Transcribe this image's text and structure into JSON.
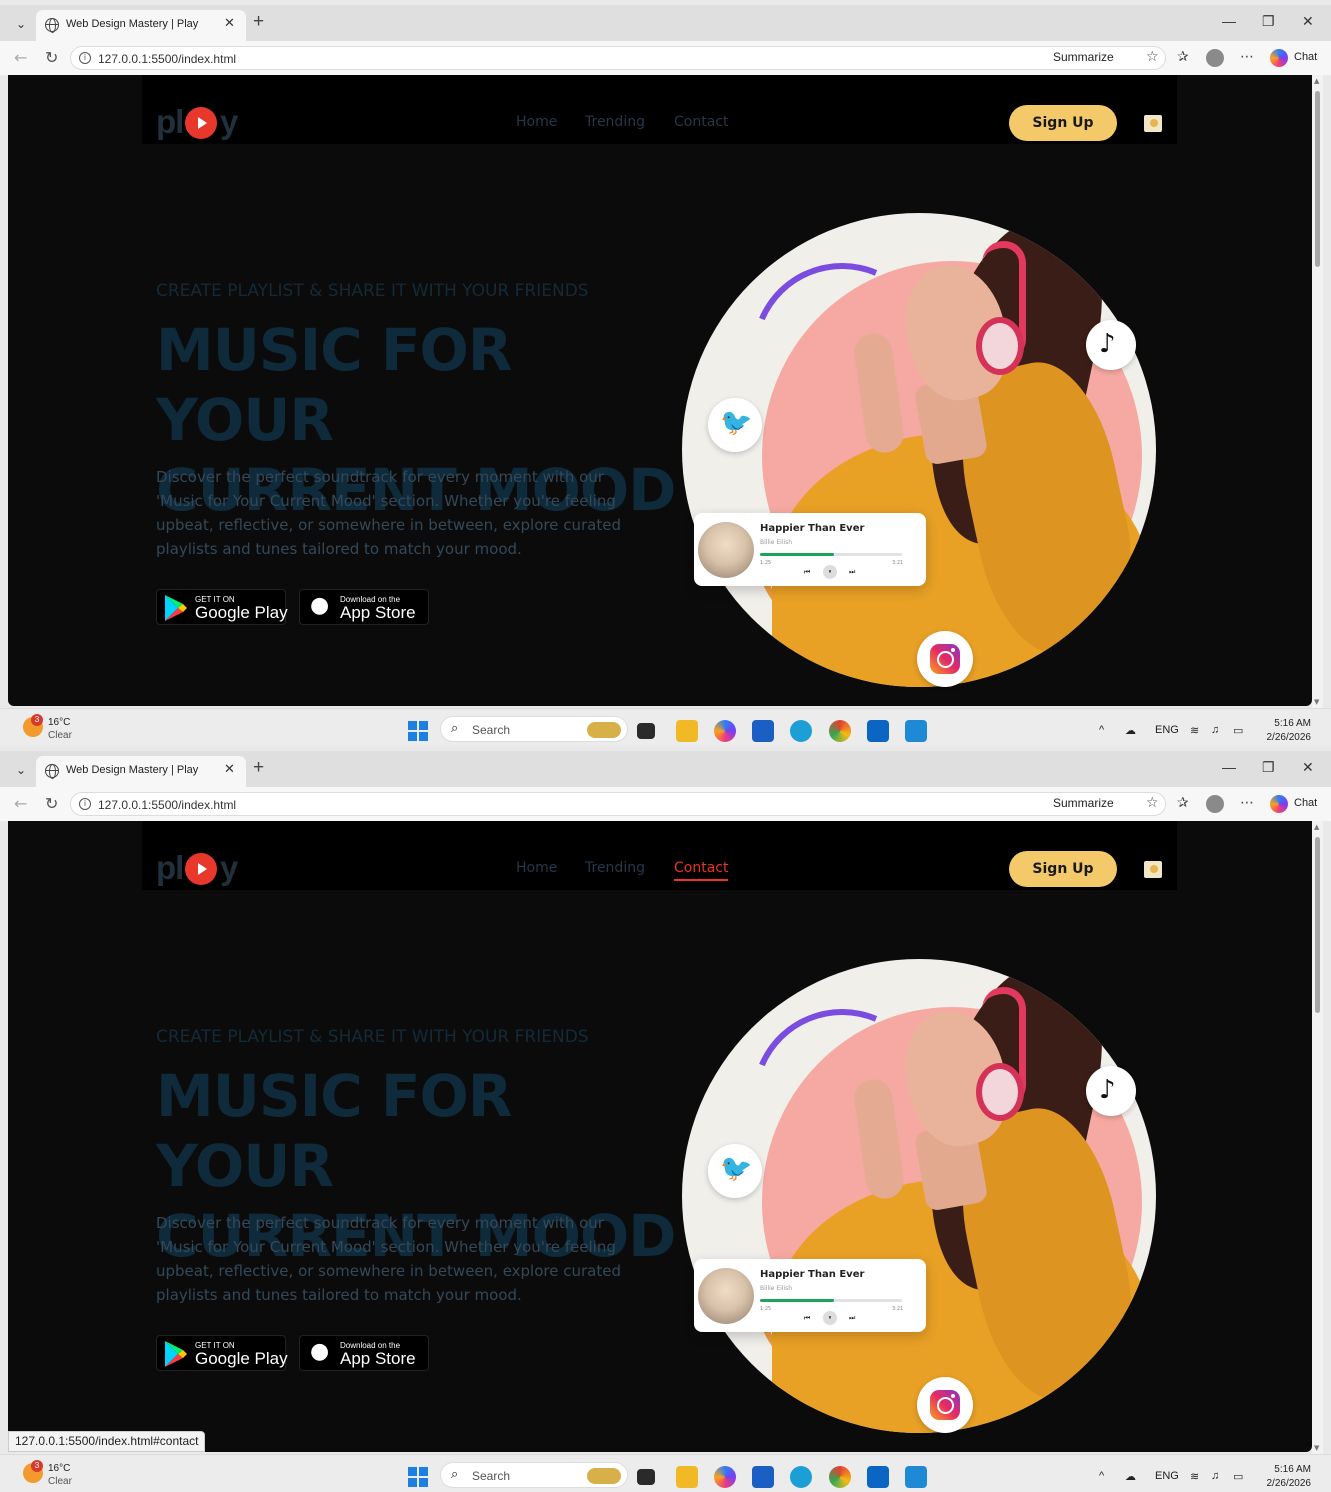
{
  "browser": {
    "tab_title": "Web Design Mastery | Play",
    "tab_close": "✕",
    "new_tab": "+",
    "url": "127.0.0.1:5500/index.html",
    "summarize": "Summarize",
    "chat": "Chat",
    "minimize": "—",
    "restore": "❐",
    "close": "✕"
  },
  "site": {
    "logo_left": "pl",
    "logo_right": "y",
    "nav": [
      "Home",
      "Trending",
      "Contact"
    ],
    "signup": "Sign Up",
    "eyebrow": "CREATE PLAYLIST & SHARE IT WITH YOUR FRIENDS",
    "headline_line1": "MUSIC FOR YOUR",
    "headline_line2": "CURRENT MOOD",
    "description": "Discover the perfect soundtrack for every moment with our 'Music for Your Current Mood' section. Whether you're feeling upbeat, reflective, or somewhere in between, explore curated playlists and tunes tailored to match your mood.",
    "google_play_small": "GET IT ON",
    "google_play_big": "Google Play",
    "app_store_small": "Download on the",
    "app_store_big": "App Store",
    "player": {
      "title": "Happier Than Ever",
      "artist": "Billie Eilish",
      "time_current": "1:25",
      "time_total": "3:21",
      "progress_percent": 52
    }
  },
  "screens": [
    {
      "active_nav": null,
      "status_url": ""
    },
    {
      "active_nav": "Contact",
      "status_url": "127.0.0.1:5500/index.html#contact"
    }
  ],
  "taskbar": {
    "weather_temp": "16°C",
    "weather_cond": "Clear",
    "weather_badge": "3",
    "search": "Search",
    "lang": "ENG",
    "time": "5:16 AM",
    "date": "2/26/2026"
  },
  "colors": {
    "accent_red": "#ea3323",
    "signup_yellow": "#f3c96a",
    "page_bg": "#0b0b0b"
  }
}
